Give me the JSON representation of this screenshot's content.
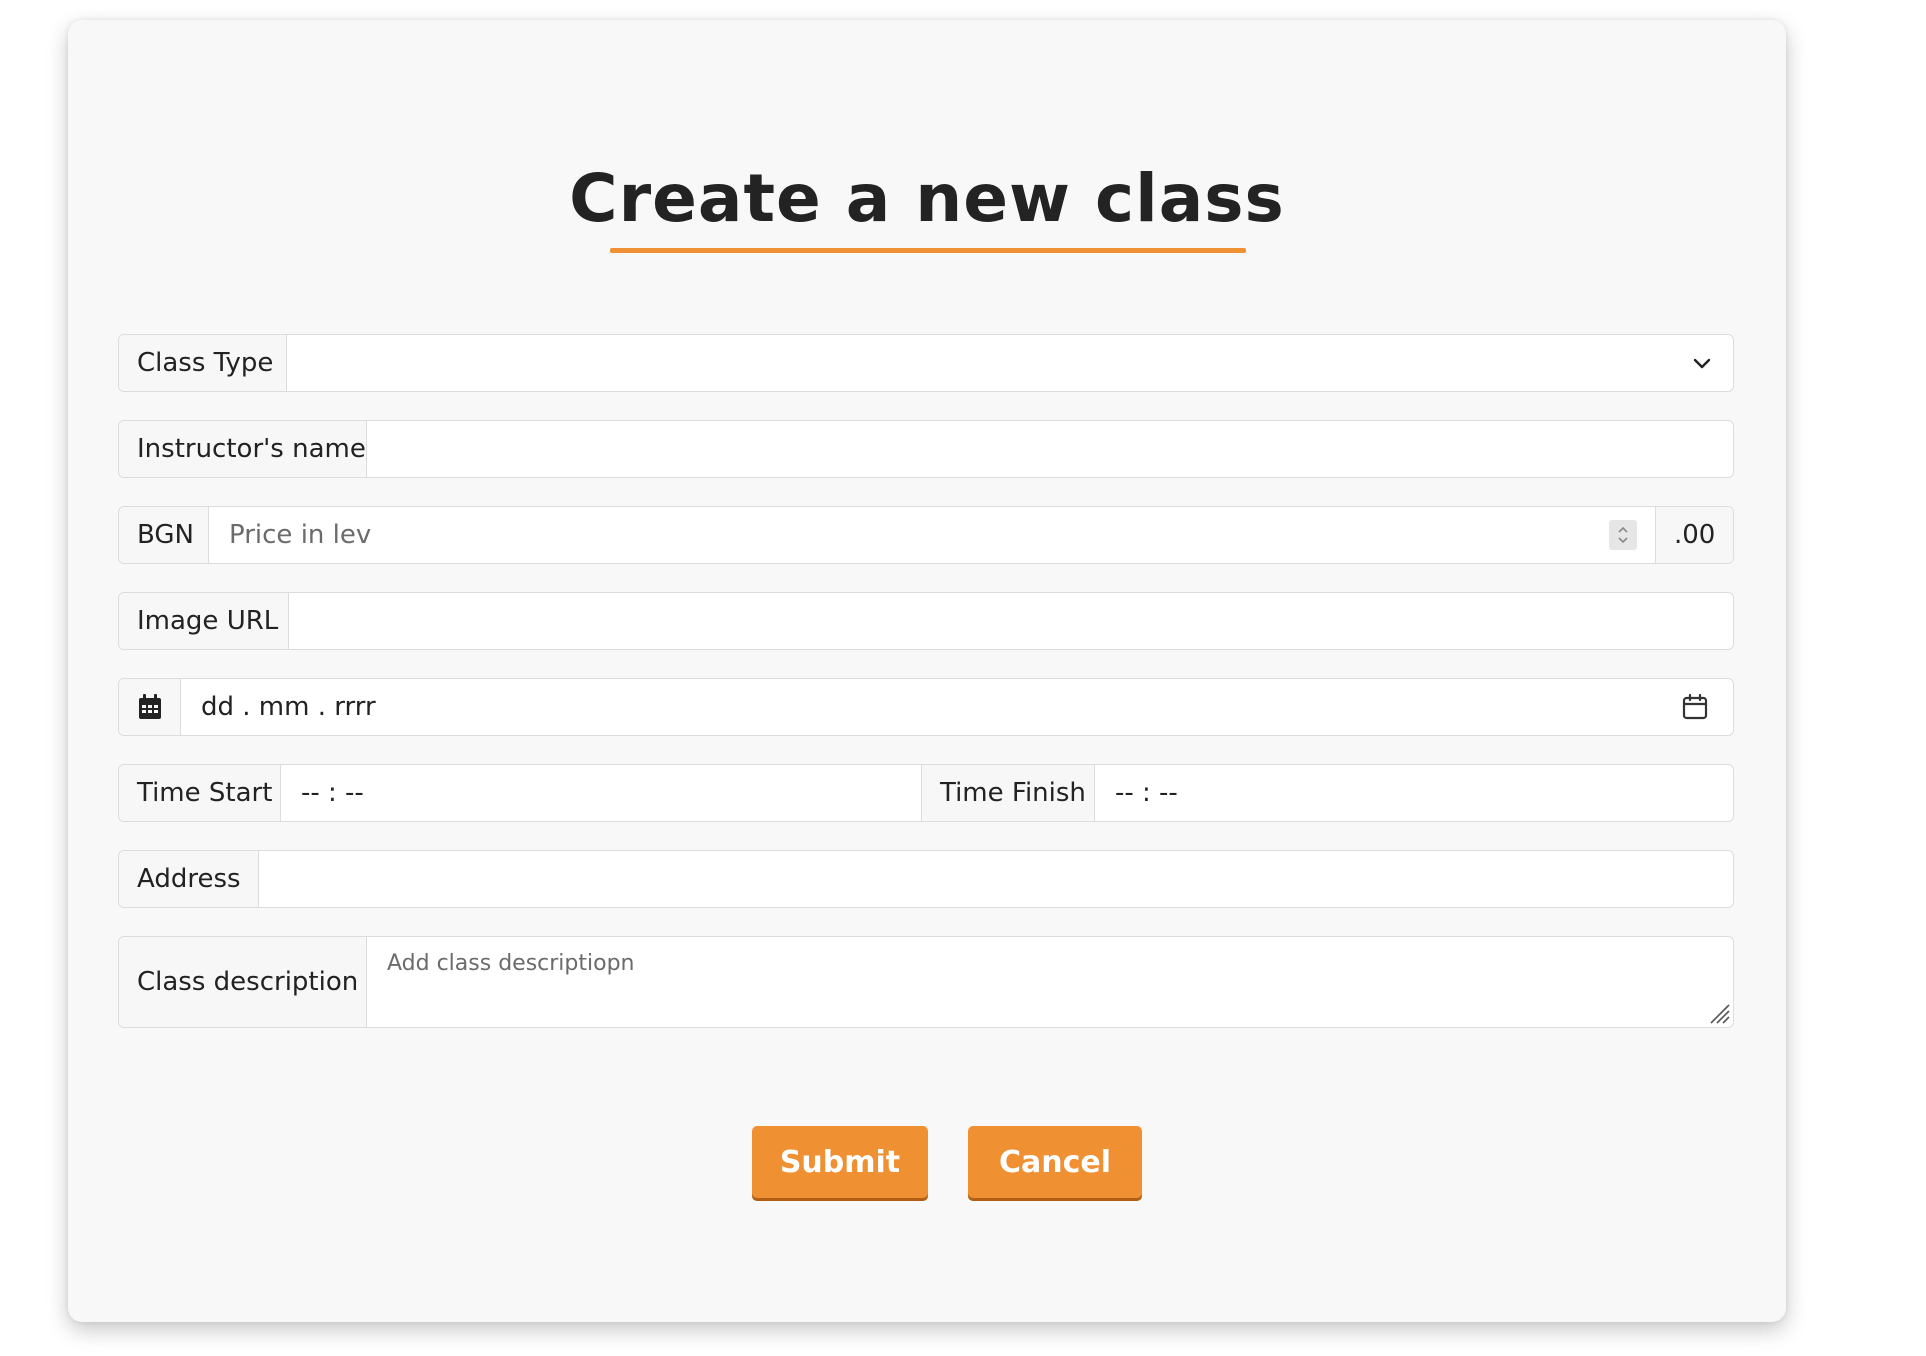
{
  "form": {
    "title": "Create a new class",
    "class_type": {
      "label": "Class Type",
      "value": ""
    },
    "instructor": {
      "label": "Instructor's name",
      "value": ""
    },
    "price": {
      "currency_label": "BGN",
      "placeholder": "Price in lev",
      "suffix": ".00"
    },
    "image_url": {
      "label": "Image URL",
      "value": ""
    },
    "date": {
      "placeholder": "dd . mm . rrrr"
    },
    "time_start": {
      "label": "Time Start",
      "placeholder": "-- : --"
    },
    "time_finish": {
      "label": "Time Finish",
      "placeholder": "-- : --"
    },
    "address": {
      "label": "Address",
      "value": ""
    },
    "description": {
      "label": "Class description",
      "placeholder": "Add class descriptiopn"
    },
    "submit_label": "Submit",
    "cancel_label": "Cancel"
  },
  "colors": {
    "accent": "#ef9033",
    "card_background": "#f8f8f8",
    "title_text": "#232323"
  },
  "icons": {
    "select_chevron": "chevron-down-icon",
    "price_spinner": "spinner-icon",
    "date_prefix": "calendar-icon",
    "date_picker": "calendar-outline-icon",
    "textarea_resize": "resize-handle-icon"
  }
}
